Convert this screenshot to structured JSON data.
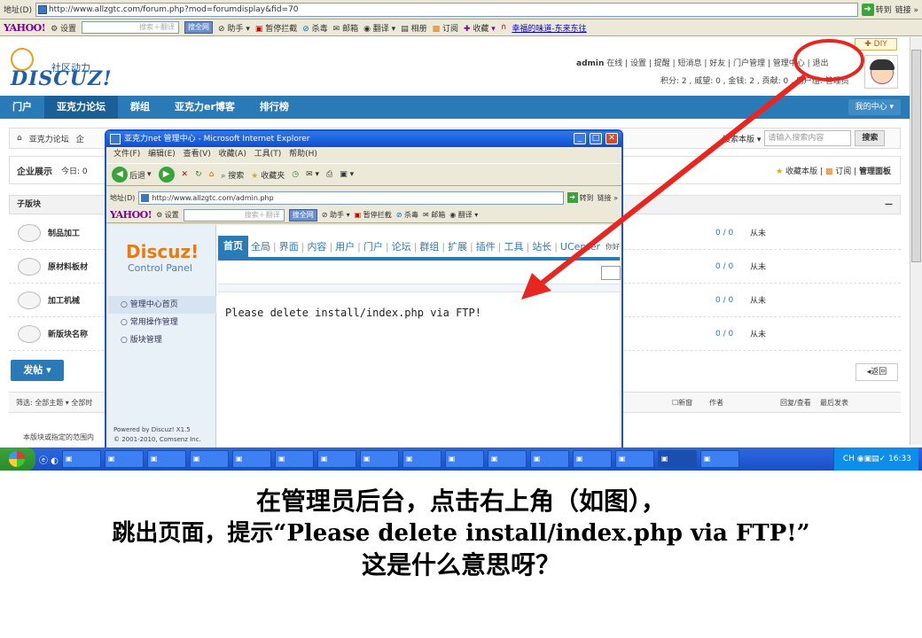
{
  "addressbar": {
    "label": "地址(D)",
    "url": "http://www.allzgtc.com/forum.php?mod=forumdisplay&fid=70",
    "go": "转到",
    "links": "链接 »"
  },
  "yahoo_toolbar": {
    "brand": "YAHOO!",
    "settings": "设置",
    "search_placeholder": "搜索＋翻译",
    "search_btn": "搜全网",
    "helper": "助手",
    "block": "暂停拦截",
    "kill": "杀毒",
    "mail": "邮箱",
    "translate": "翻译",
    "album": "相册",
    "subscribe": "订阅",
    "favorites": "收藏",
    "link": "幸福的味道-东来东往"
  },
  "forum": {
    "logo_text": "DISCUZ!",
    "logo_sub": "社区动力",
    "diy": "DIY",
    "user": "admin",
    "userline": "在线 | 设置 | 提醒 | 短消息 | 好友 | 门户管理 | 管理中心 | 退出",
    "points": "积分: 2 , 威望: 0 , 金钱: 2 , 贡献: 0 , 用户组: 管理员",
    "nav": [
      "门户",
      "亚克力论坛",
      "群组",
      "亚克力er博客",
      "排行榜"
    ],
    "my_center": "我的中心",
    "crumb": [
      "亚克力论坛",
      "企"
    ],
    "search_scope": "搜索本版",
    "search_placeholder": "请输入搜索内容",
    "search_btn": "搜索",
    "section_title": "企业展示",
    "today": "今日: 0",
    "fav": "收藏本版",
    "sub": "订阅",
    "manage": "管理面板",
    "subforum_header": "子版块",
    "subforums": [
      {
        "name": "制品加工",
        "count": "0 / 0",
        "last": "从未"
      },
      {
        "name": "原材料板材",
        "count": "0 / 0",
        "last": "从未"
      },
      {
        "name": "加工机械",
        "count": "0 / 0",
        "last": "从未"
      },
      {
        "name": "新版块名称",
        "count": "0 / 0",
        "last": "从未"
      }
    ],
    "post_btn": "发帖",
    "back_btn": "返回",
    "filter": "筛选: 全部主题 ▾  全部时",
    "new_window": "新窗",
    "author": "作者",
    "replies": "回复/查看",
    "last_post": "最后发表",
    "note": "本版块或指定的范围内"
  },
  "popup": {
    "title": "亚克力net 管理中心 - Microsoft Internet Explorer",
    "menu": "文件(F) 编辑(E) 查看(V) 收藏(A) 工具(T) 帮助(H)",
    "back": "后退",
    "search": "搜索",
    "fav": "收藏夹",
    "addr_label": "地址(D)",
    "url": "http://www.allzgtc.com/admin.php",
    "go": "转到",
    "links": "链接 »",
    "yahoo_brand": "YAHOO!",
    "y_settings": "设置",
    "y_search_placeholder": "搜索＋翻译",
    "y_search_btn": "搜全网",
    "y_helper": "助手",
    "y_block": "暂停拦截",
    "y_kill": "杀毒",
    "y_mail": "邮箱",
    "y_translate": "翻译",
    "brand": "Discuz!",
    "brand_sub": "Control Panel",
    "tabs": [
      "首页",
      "全局",
      "界面",
      "内容",
      "用户",
      "门户",
      "论坛",
      "群组",
      "扩展",
      "插件",
      "工具",
      "站长",
      "UCenter"
    ],
    "tab_extra": "你好",
    "side_menu": [
      "管理中心首页",
      "常用操作管理",
      "版块管理"
    ],
    "powered": "Powered by Discuz! X1.5",
    "copyright": "© 2001-2010, Comsenz Inc.",
    "message": "Please delete install/index.php via FTP!"
  },
  "taskbar": {
    "items": [
      "",
      "",
      "",
      "",
      "",
      "",
      "",
      "",
      "",
      "",
      "",
      "",
      "",
      "",
      "",
      "",
      "",
      "",
      ""
    ],
    "clock": "16:33",
    "lang": "CH"
  },
  "caption": {
    "line1": "在管理员后台，点击右上角（如图），",
    "line2": "跳出页面，提示“Please delete install/index.php via FTP!”",
    "line3": "这是什么意思呀？"
  },
  "annotation_color": "#e8251f",
  "accent": "#2b7ab8"
}
